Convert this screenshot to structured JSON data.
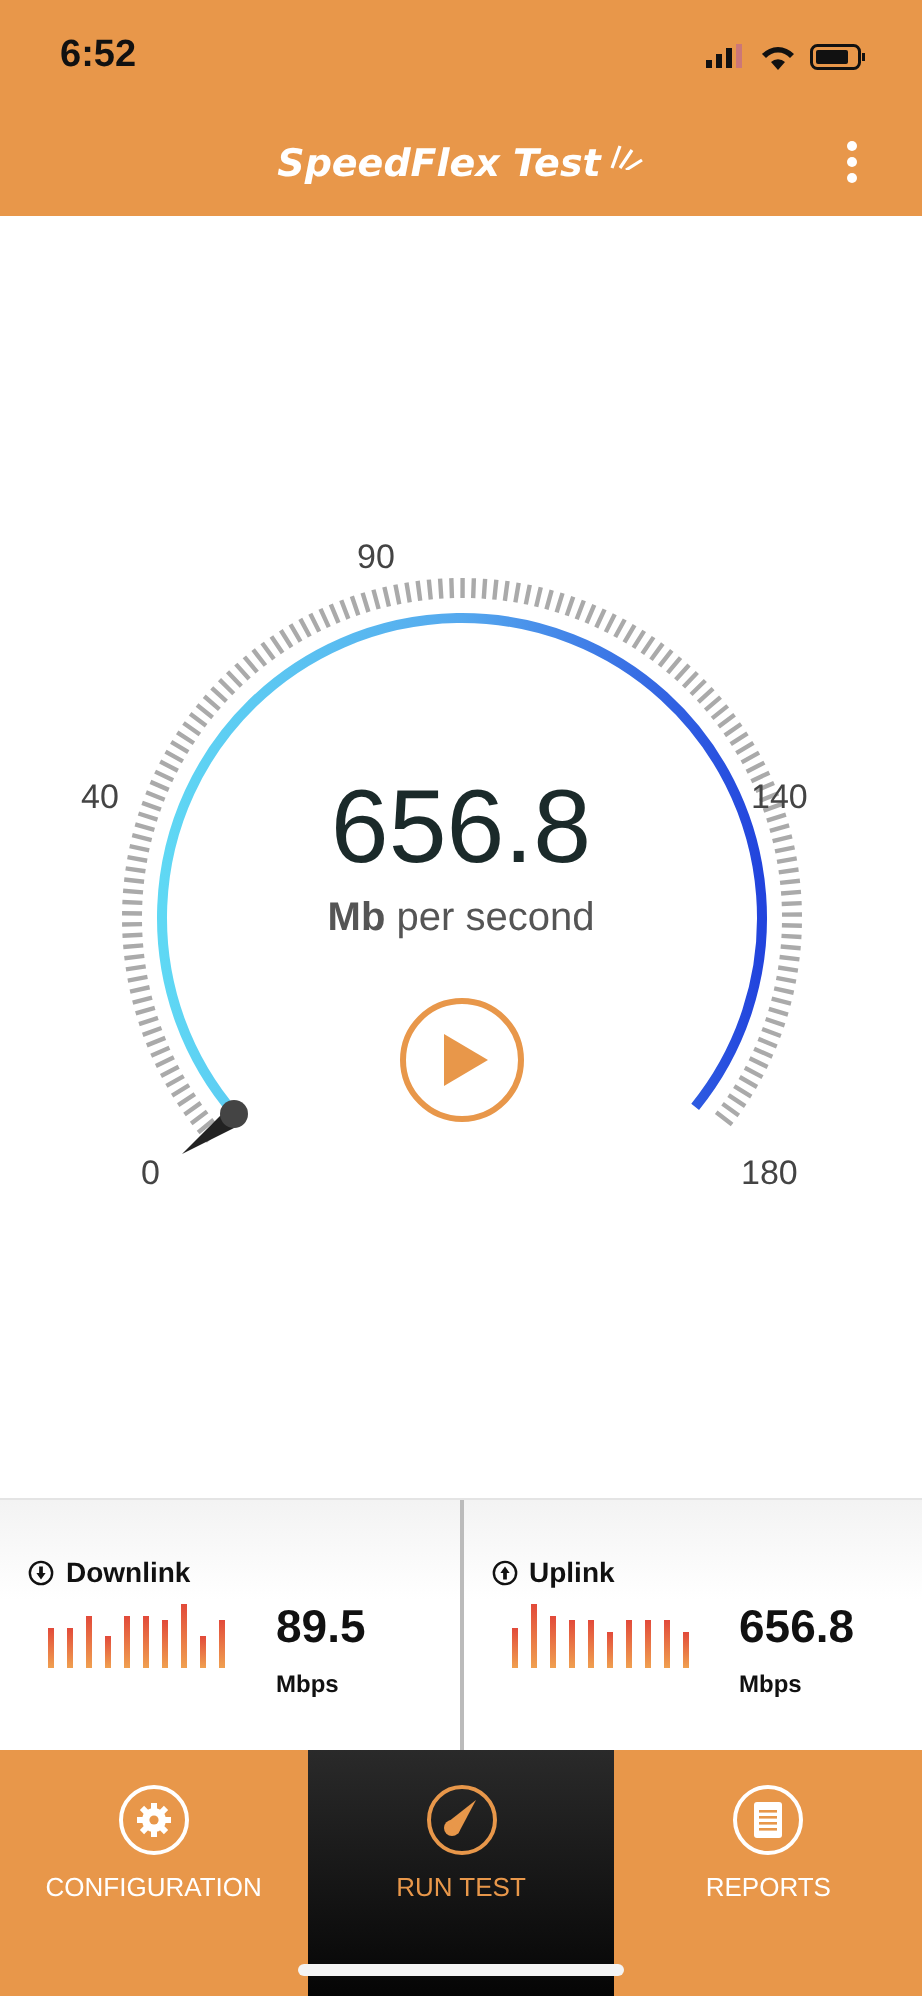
{
  "status_bar": {
    "time": "6:52"
  },
  "header": {
    "title": "SpeedFlex Test"
  },
  "gauge": {
    "scale_labels": [
      "0",
      "40",
      "90",
      "140",
      "180"
    ],
    "value": "656.8",
    "unit": "Mb",
    "unit_suffix": "per second"
  },
  "results": [
    {
      "kind": "down",
      "label": "Downlink",
      "value": "89.5",
      "unit": "Mbps"
    },
    {
      "kind": "up",
      "label": "Uplink",
      "value": "656.8",
      "unit": "Mbps"
    }
  ],
  "tabs": [
    {
      "kind": "config",
      "label": "CONFIGURATION",
      "selected": false
    },
    {
      "kind": "run",
      "label": "RUN TEST",
      "selected": true
    },
    {
      "kind": "reports",
      "label": "REPORTS",
      "selected": false
    }
  ]
}
